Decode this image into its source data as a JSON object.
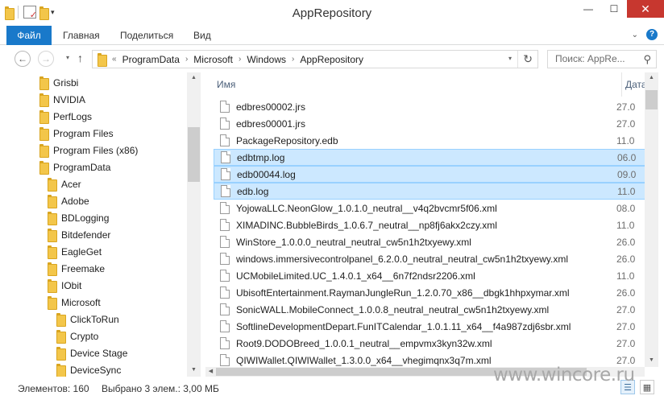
{
  "window": {
    "title": "AppRepository"
  },
  "ribbon": {
    "tabs": [
      "Файл",
      "Главная",
      "Поделиться",
      "Вид"
    ]
  },
  "address": {
    "prefix": "«",
    "crumbs": [
      "ProgramData",
      "Microsoft",
      "Windows",
      "AppRepository"
    ]
  },
  "search": {
    "placeholder": "Поиск: AppRe..."
  },
  "nav_tree": [
    {
      "label": "Grisbi",
      "level": 0
    },
    {
      "label": "NVIDIA",
      "level": 0
    },
    {
      "label": "PerfLogs",
      "level": 0
    },
    {
      "label": "Program Files",
      "level": 0
    },
    {
      "label": "Program Files (x86)",
      "level": 0
    },
    {
      "label": "ProgramData",
      "level": 0
    },
    {
      "label": "Acer",
      "level": 1
    },
    {
      "label": "Adobe",
      "level": 1
    },
    {
      "label": "BDLogging",
      "level": 1
    },
    {
      "label": "Bitdefender",
      "level": 1
    },
    {
      "label": "EagleGet",
      "level": 1
    },
    {
      "label": "Freemake",
      "level": 1
    },
    {
      "label": "IObit",
      "level": 1
    },
    {
      "label": "Microsoft",
      "level": 1
    },
    {
      "label": "ClickToRun",
      "level": 2
    },
    {
      "label": "Crypto",
      "level": 2
    },
    {
      "label": "Device Stage",
      "level": 2
    },
    {
      "label": "DeviceSync",
      "level": 2
    }
  ],
  "columns": {
    "name": "Имя",
    "date": "Дата"
  },
  "files": [
    {
      "name": "edbres00002.jrs",
      "date": "27.0",
      "selected": false
    },
    {
      "name": "edbres00001.jrs",
      "date": "27.0",
      "selected": false
    },
    {
      "name": "PackageRepository.edb",
      "date": "11.0",
      "selected": false
    },
    {
      "name": "edbtmp.log",
      "date": "06.0",
      "selected": true
    },
    {
      "name": "edb00044.log",
      "date": "09.0",
      "selected": true
    },
    {
      "name": "edb.log",
      "date": "11.0",
      "selected": true
    },
    {
      "name": "YojowaLLC.NeonGlow_1.0.1.0_neutral__v4q2bvcmr5f06.xml",
      "date": "08.0",
      "selected": false
    },
    {
      "name": "XIMADINC.BubbleBirds_1.0.6.7_neutral__np8fj6akx2czy.xml",
      "date": "11.0",
      "selected": false
    },
    {
      "name": "WinStore_1.0.0.0_neutral_neutral_cw5n1h2txyewy.xml",
      "date": "26.0",
      "selected": false
    },
    {
      "name": "windows.immersivecontrolpanel_6.2.0.0_neutral_neutral_cw5n1h2txyewy.xml",
      "date": "26.0",
      "selected": false
    },
    {
      "name": "UCMobileLimited.UC_1.4.0.1_x64__6n7f2ndsr2206.xml",
      "date": "11.0",
      "selected": false
    },
    {
      "name": "UbisoftEntertainment.RaymanJungleRun_1.2.0.70_x86__dbgk1hhpxymar.xml",
      "date": "26.0",
      "selected": false
    },
    {
      "name": "SonicWALL.MobileConnect_1.0.0.8_neutral_neutral_cw5n1h2txyewy.xml",
      "date": "27.0",
      "selected": false
    },
    {
      "name": "SoftlineDevelopmentDepart.FunITCalendar_1.0.1.11_x64__f4a987zdj6sbr.xml",
      "date": "27.0",
      "selected": false
    },
    {
      "name": "Root9.DODOBreed_1.0.0.1_neutral__empvmx3kyn32w.xml",
      "date": "27.0",
      "selected": false
    },
    {
      "name": "QIWIWallet.QIWIWallet_1.3.0.0_x64__vhegimqnx3q7m.xml",
      "date": "27.0",
      "selected": false
    }
  ],
  "status": {
    "count": "Элементов: 160",
    "selection": "Выбрано 3 элем.: 3,00 МБ"
  },
  "watermark": "www.wincore.ru",
  "colors": {
    "accent": "#1979ca",
    "selection_bg": "#cce8ff",
    "selection_border": "#99d1ff",
    "close": "#c7372f"
  }
}
